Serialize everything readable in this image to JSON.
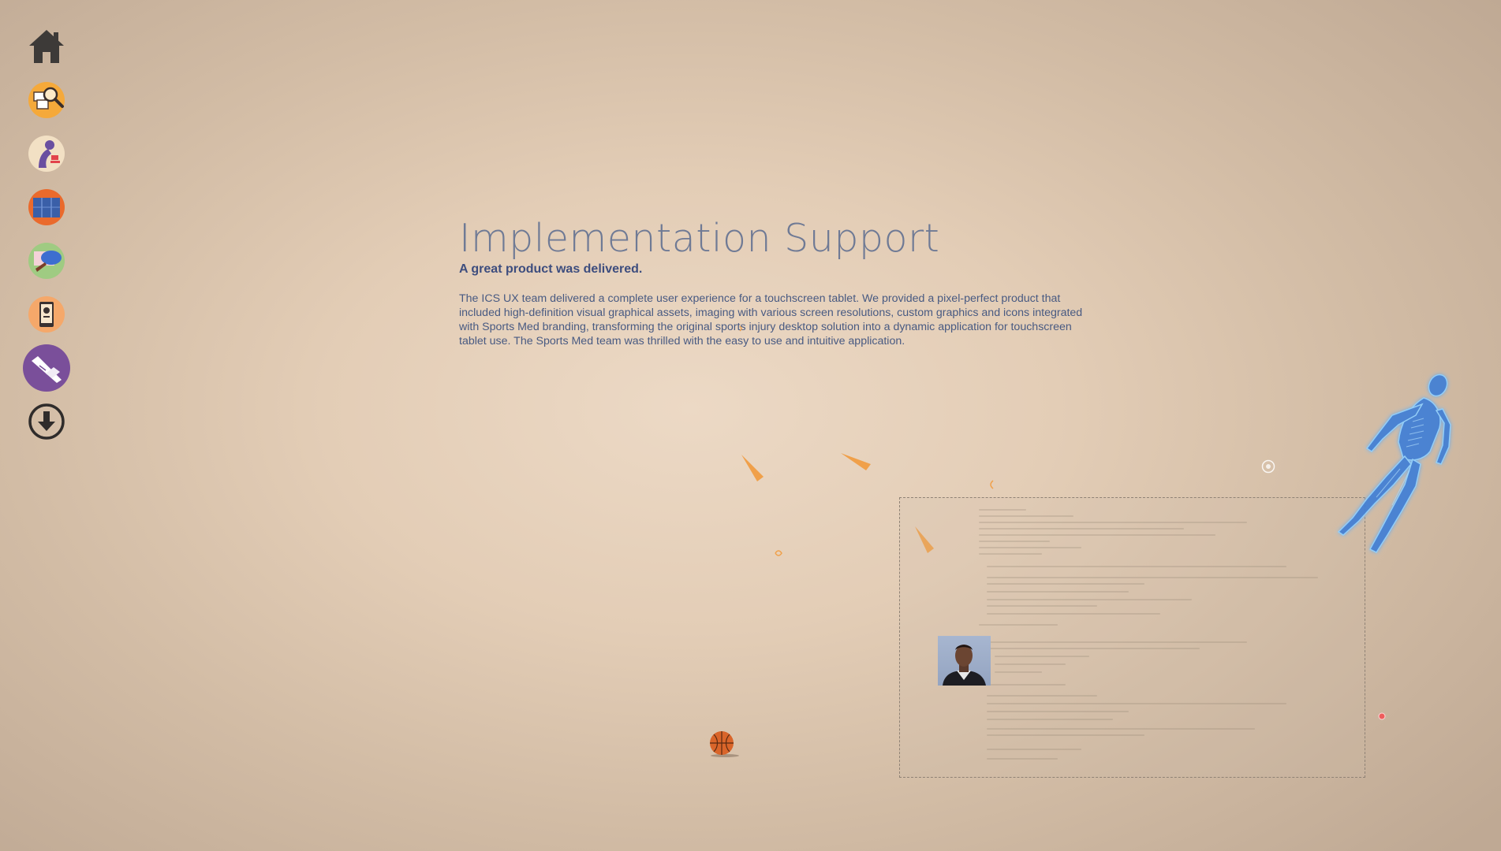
{
  "nav": {
    "items": [
      {
        "name": "home",
        "icon": "house-icon"
      },
      {
        "name": "research",
        "icon": "magnifier-screens-icon",
        "color": "#f5a93a"
      },
      {
        "name": "science",
        "icon": "microscope-icon",
        "color": "#f2e0c4"
      },
      {
        "name": "layout",
        "icon": "blueprint-icon",
        "color": "#ea6a2c"
      },
      {
        "name": "design",
        "icon": "palette-screen-icon",
        "color": "#9fcb82"
      },
      {
        "name": "mobile",
        "icon": "tablet-app-icon",
        "color": "#f5a86a"
      },
      {
        "name": "support",
        "icon": "handshake-icon",
        "color": "#7a4f9a",
        "active": true
      },
      {
        "name": "download",
        "icon": "download-arrow-icon"
      }
    ]
  },
  "content": {
    "title": "Implementation Support",
    "subtitle": "A great product was delivered.",
    "body": "The ICS UX team delivered a complete user experience for a touchscreen tablet. We provided a pixel-perfect product that included high-definition visual graphical assets, imaging with various screen resolutions, custom graphics and icons integrated with Sports Med branding, transforming the original sports injury desktop solution into a dynamic application for touchscreen tablet use. The Sports Med team was thrilled with the easy to use and intuitive application."
  },
  "colors": {
    "title": "#6f7a95",
    "subtitle": "#3d4d7e",
    "body": "#485a82",
    "shard": "#f0a04a",
    "skeleton": "#3f7fd6"
  },
  "decor": {
    "basketball": "basketball-icon",
    "skeleton": "human-skeleton-illustration",
    "photo": "player-photo"
  }
}
